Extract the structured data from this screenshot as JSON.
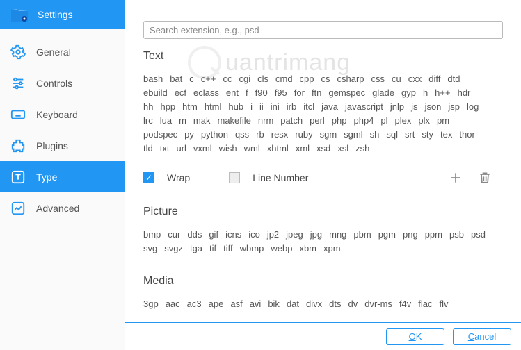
{
  "header": {
    "title": "Settings"
  },
  "sidebar": {
    "items": [
      {
        "label": "General"
      },
      {
        "label": "Controls"
      },
      {
        "label": "Keyboard"
      },
      {
        "label": "Plugins"
      },
      {
        "label": "Type"
      },
      {
        "label": "Advanced"
      }
    ],
    "active_index": 4
  },
  "search": {
    "placeholder": "Search extension, e.g., psd"
  },
  "sections": {
    "text": {
      "title": "Text",
      "extensions": [
        "bash",
        "bat",
        "c",
        "c++",
        "cc",
        "cgi",
        "cls",
        "cmd",
        "cpp",
        "cs",
        "csharp",
        "css",
        "cu",
        "cxx",
        "diff",
        "dtd",
        "ebuild",
        "ecf",
        "eclass",
        "ent",
        "f",
        "f90",
        "f95",
        "for",
        "ftn",
        "gemspec",
        "glade",
        "gyp",
        "h",
        "h++",
        "hdr",
        "hh",
        "hpp",
        "htm",
        "html",
        "hub",
        "i",
        "ii",
        "ini",
        "irb",
        "itcl",
        "java",
        "javascript",
        "jnlp",
        "js",
        "json",
        "jsp",
        "log",
        "lrc",
        "lua",
        "m",
        "mak",
        "makefile",
        "nrm",
        "patch",
        "perl",
        "php",
        "php4",
        "pl",
        "plex",
        "plx",
        "pm",
        "podspec",
        "py",
        "python",
        "qss",
        "rb",
        "resx",
        "ruby",
        "sgm",
        "sgml",
        "sh",
        "sql",
        "srt",
        "sty",
        "tex",
        "thor",
        "tld",
        "txt",
        "url",
        "vxml",
        "wish",
        "wml",
        "xhtml",
        "xml",
        "xsd",
        "xsl",
        "zsh"
      ]
    },
    "picture": {
      "title": "Picture",
      "extensions": [
        "bmp",
        "cur",
        "dds",
        "gif",
        "icns",
        "ico",
        "jp2",
        "jpeg",
        "jpg",
        "mng",
        "pbm",
        "pgm",
        "png",
        "ppm",
        "psb",
        "psd",
        "svg",
        "svgz",
        "tga",
        "tif",
        "tiff",
        "wbmp",
        "webp",
        "xbm",
        "xpm"
      ]
    },
    "media": {
      "title": "Media",
      "extensions": [
        "3gp",
        "aac",
        "ac3",
        "ape",
        "asf",
        "avi",
        "bik",
        "dat",
        "divx",
        "dts",
        "dv",
        "dvr-ms",
        "f4v",
        "flac",
        "flv"
      ]
    }
  },
  "options": {
    "wrap": {
      "label": "Wrap",
      "checked": true
    },
    "line_number": {
      "label": "Line Number",
      "checked": false
    }
  },
  "footer": {
    "ok": "OK",
    "cancel": "Cancel"
  },
  "watermark": "uantrimang",
  "colors": {
    "accent": "#2196f3"
  }
}
